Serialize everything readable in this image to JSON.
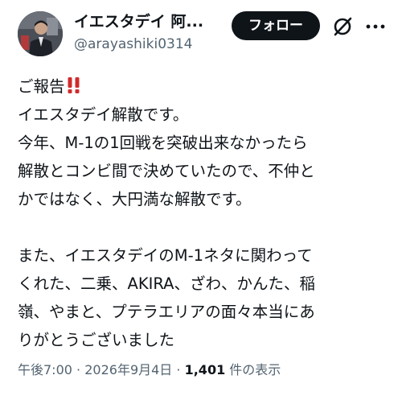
{
  "header": {
    "display_name": "イエスタデイ 阿...",
    "handle": "@arayashiki0314",
    "follow_label": "フォロー",
    "grok_icon": "slashed-circle-icon",
    "more_icon": "more-dots-icon"
  },
  "avatar": {
    "icon": "profile-photo-avatar"
  },
  "tweet": {
    "lines": [
      "ご報告",
      "イエスタデイ解散です。",
      "今年、M-1の1回戦を突破出来なかったら",
      "解散とコンビ間で決めていたので、不仲と",
      "かではなく、大円満な解散です。",
      "",
      "また、イエスタデイのM-1ネタに関わって",
      "くれた、二乗、AKIRA、ざわ、かんた、稲",
      "嶺、やまと、プテラエリアの面々本当にあ",
      "りがとうございました"
    ],
    "emoji_after_first_line": "‼️",
    "emoji_color": "#d12b2b"
  },
  "meta": {
    "time": "午後7:00",
    "separator": "·",
    "date": "2026年9月4日",
    "views_count": "1,401",
    "views_label": "件の表示"
  },
  "colors": {
    "text_primary": "#0f1419",
    "text_secondary": "#536471",
    "button_bg": "#0f1419",
    "button_text": "#ffffff"
  }
}
